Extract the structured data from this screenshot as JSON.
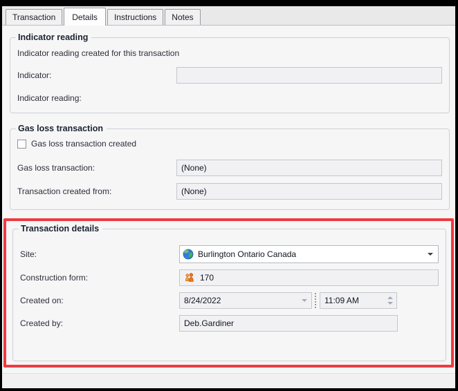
{
  "tabs": {
    "items": [
      {
        "label": "Transaction",
        "active": false
      },
      {
        "label": "Details",
        "active": true
      },
      {
        "label": "Instructions",
        "active": false
      },
      {
        "label": "Notes",
        "active": false
      }
    ]
  },
  "indicator_reading": {
    "title": "Indicator reading",
    "description": "Indicator reading created for this transaction",
    "indicator_label": "Indicator:",
    "indicator_value": "",
    "reading_label": "Indicator reading:"
  },
  "gas_loss": {
    "title": "Gas loss transaction",
    "created_checkbox_label": "Gas loss transaction created",
    "created_checkbox_checked": false,
    "transaction_label": "Gas loss transaction:",
    "transaction_value": "(None)",
    "created_from_label": "Transaction created from:",
    "created_from_value": "(None)"
  },
  "transaction_details": {
    "title": "Transaction details",
    "site_label": "Site:",
    "site_value": "Burlington Ontario Canada",
    "construction_form_label": "Construction form:",
    "construction_form_value": "170",
    "created_on_label": "Created on:",
    "created_on_date": "8/24/2022",
    "created_on_time": "11:09 AM",
    "created_by_label": "Created by:",
    "created_by_value": "Deb.Gardiner"
  },
  "icons": {
    "site": "globe-icon",
    "construction_form": "people-icon",
    "site_dropdown": "chevron-down-icon",
    "date_dropdown": "chevron-down-icon",
    "time_spinner": "up-down-spinner-icon"
  },
  "colors": {
    "highlight_red": "#ee3a40",
    "window_bg": "#f6f6f7",
    "field_bg": "#f1f1f4"
  }
}
